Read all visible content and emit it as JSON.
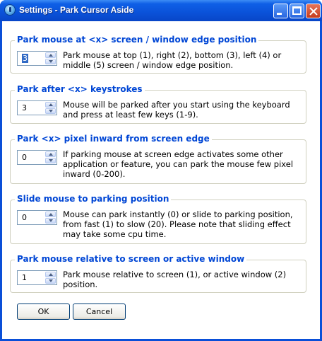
{
  "window": {
    "title": "Settings - Park Cursor Aside",
    "controls": [
      "minimize",
      "maximize",
      "close"
    ]
  },
  "groups": [
    {
      "title": "Park mouse at <x> screen / window edge position",
      "value": "3",
      "description": "Park mouse at top (1), right (2), bottom (3), left (4) or middle (5) screen / window edge position."
    },
    {
      "title": "Park after <x> keystrokes",
      "value": "3",
      "description": "Mouse will be parked after you start using the keyboard and press at least few keys (1-9)."
    },
    {
      "title": "Park <x> pixel inward from screen edge",
      "value": "0",
      "description": "If parking mouse at screen edge activates some other application or feature, you can park the mouse few pixel inward (0-200)."
    },
    {
      "title": "Slide mouse to parking position",
      "value": "0",
      "description": "Mouse can park instantly (0) or slide to parking position, from fast (1) to slow (20). Please note that sliding effect may take some cpu time."
    },
    {
      "title": "Park mouse relative to screen or active window",
      "value": "1",
      "description": "Park mouse relative to screen (1), or active window (2) position."
    }
  ],
  "buttons": {
    "ok": "OK",
    "cancel": "Cancel"
  }
}
